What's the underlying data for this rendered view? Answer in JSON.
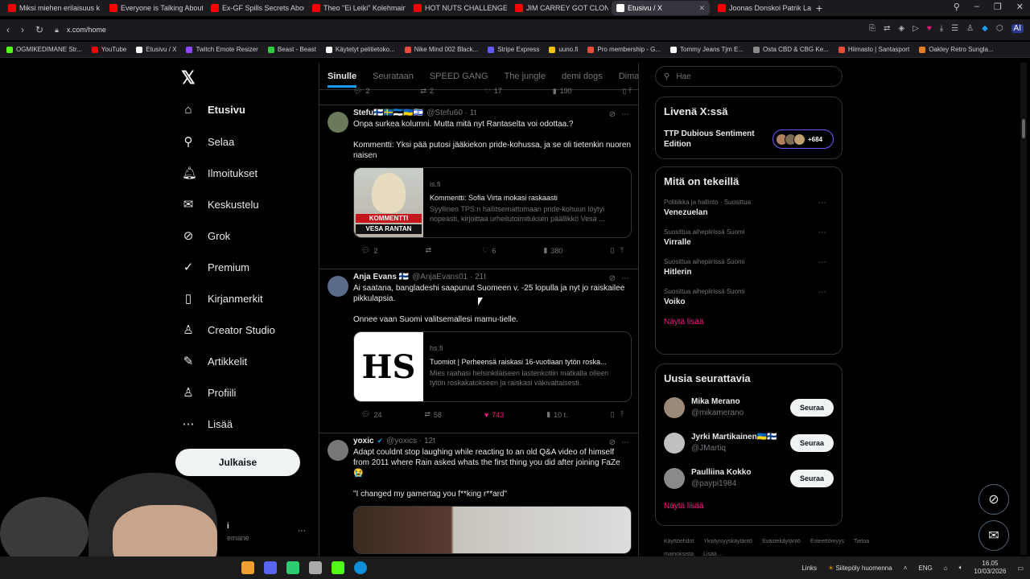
{
  "browser": {
    "tabs": [
      {
        "title": "Miksi miehen erilaisuus k",
        "color": "#ff0000"
      },
      {
        "title": "Everyone is Talking About",
        "color": "#ff0000"
      },
      {
        "title": "Ex-GF Spills Secrets About",
        "color": "#ff0000"
      },
      {
        "title": "Theo \"Ei Leiki\" Kolehmain",
        "color": "#ff0000"
      },
      {
        "title": "HOT NUTS CHALLENGE -",
        "color": "#ff0000"
      },
      {
        "title": "JIM CARREY GOT CLONED",
        "color": "#ff0000"
      },
      {
        "title": "Etusivu / X",
        "color": "#ffffff"
      },
      {
        "title": "Joonas Donskoi Patrik La",
        "color": "#ff0000"
      }
    ],
    "url": "x.com/home",
    "bookmarks": [
      {
        "label": "OGMIKEDIMANE Str...",
        "color": "#53fc18"
      },
      {
        "label": "YouTube",
        "color": "#ff0000"
      },
      {
        "label": "Etusivu / X",
        "color": "#ffffff"
      },
      {
        "label": "Twitch Emote Resizer",
        "color": "#9146ff"
      },
      {
        "label": "Beast - Beast",
        "color": "#2ecc40"
      },
      {
        "label": "Käytetyt pelitietoko...",
        "color": "#ffffff"
      },
      {
        "label": "Nike Mind 002 Black...",
        "color": "#e74c3c"
      },
      {
        "label": "Stripe Express",
        "color": "#635bff"
      },
      {
        "label": "uuno.fi",
        "color": "#f1c40f"
      },
      {
        "label": "Pro membership - G...",
        "color": "#e74c3c"
      },
      {
        "label": "Tommy Jeans Tjm E...",
        "color": "#ffffff"
      },
      {
        "label": "Osta CBD & CBG Ke...",
        "color": "#888888"
      },
      {
        "label": "Hiimasto | Santasport",
        "color": "#e74c3c"
      },
      {
        "label": "Oakley Retro Sungla...",
        "color": "#e67e22"
      }
    ]
  },
  "nav": {
    "items": [
      {
        "label": "Etusivu",
        "icon": "home-icon",
        "glyph": "⌂"
      },
      {
        "label": "Selaa",
        "icon": "search-icon",
        "glyph": "⚲"
      },
      {
        "label": "Ilmoitukset",
        "icon": "bell-icon",
        "glyph": "🔔︎"
      },
      {
        "label": "Keskustelu",
        "icon": "envelope-icon",
        "glyph": "✉"
      },
      {
        "label": "Grok",
        "icon": "grok-icon",
        "glyph": "⊘"
      },
      {
        "label": "Premium",
        "icon": "verified-icon",
        "glyph": "✓"
      },
      {
        "label": "Kirjanmerkit",
        "icon": "bookmark-icon",
        "glyph": "▯"
      },
      {
        "label": "Creator Studio",
        "icon": "creator-icon",
        "glyph": "♙"
      },
      {
        "label": "Artikkelit",
        "icon": "article-icon",
        "glyph": "✎"
      },
      {
        "label": "Profiili",
        "icon": "profile-icon",
        "glyph": "♙"
      },
      {
        "label": "Lisää",
        "icon": "more-icon",
        "glyph": "⋯"
      }
    ],
    "post_button": "Julkaise",
    "user_name": "i",
    "user_handle": "emane"
  },
  "feed": {
    "tabs": [
      "Sinulle",
      "Seurataan",
      "SPEED GANG",
      "The jungle",
      "demi dogs",
      "Dima's Dist"
    ],
    "top_actions": {
      "replies": "2",
      "reposts": "2",
      "likes": "17",
      "views": "190"
    },
    "posts": [
      {
        "name": "Stefu🇫🇮🇸🇪🇪🇪🇺🇦🇮🇱",
        "handle": "@Stefu60 · 1t",
        "text1": "Onpa surkea kolumni. Mutta mitä nyt Rantaselta voi odottaa.?",
        "text2": "Kommentti: Yksi pää putosi jääkiekon pride-kohussa, ja se oli tietenkin nuoren naisen",
        "card": {
          "domain": "is.fi",
          "title": "Kommentti: Sofia Virta mokasi raskaasti",
          "desc": "Syyllinen TPS:n hallitsemattomaan pride-kohuun löytyi nopeasti, kirjoittaa urheilutoimituksen päällikkö Vesa ...",
          "overlay1": "KOMMENTTI",
          "overlay2": "VESA RANTAN"
        },
        "actions": {
          "replies": "2",
          "reposts": "",
          "likes": "6",
          "views": "380"
        }
      },
      {
        "name": "Anja Evans 🇫🇮",
        "handle": "@AnjaEvans01 · 21t",
        "text1": "Ai saatana, bangladeshi saapunut Suomeen v. -25 lopulla ja nyt jo raiskailee pikkulapsia.",
        "text2": "Onnee vaan Suomi valitsemallesi mamu-tielle.",
        "card": {
          "domain": "hs.fi",
          "title": "Tuomiot | Perheensä raiskasi 16-vuotiaan tytön roska...",
          "desc": "Mies raahasi helsinkiläiseen lastenkotiin matkalla olleen tytön roskakatokseen ja raiskasi väkivaltaisesti.",
          "logo": "HS"
        },
        "actions": {
          "replies": "24",
          "reposts": "58",
          "likes": "743",
          "views": "10 t."
        }
      },
      {
        "name": "yoxic",
        "handle": "@yoxics · 12t",
        "text1": "Adapt couldnt stop laughing while reacting to an old Q&A video of himself from 2011 where Rain asked whats the first thing you did after joining FaZe 😭",
        "text2": "\"I changed my gamertag you f**king r**ard\""
      }
    ]
  },
  "right": {
    "search_placeholder": "Hae",
    "live": {
      "title": "Livenä X:ssä",
      "event": "TTP Dubious Sentiment Edition",
      "count": "+684"
    },
    "trends": {
      "title": "Mitä on tekeillä",
      "items": [
        {
          "meta": "Politiikka ja hallinto · Suosittua",
          "name": "Venezuelan"
        },
        {
          "meta": "Suosittua aihepiirissä Suomi",
          "name": "Virralle"
        },
        {
          "meta": "Suosittua aihepiirissä Suomi",
          "name": "Hitlerin"
        },
        {
          "meta": "Suosittua aihepiirissä Suomi",
          "name": "Voiko"
        }
      ],
      "show_more": "Näytä lisää"
    },
    "who_to_follow": {
      "title": "Uusia seurattavia",
      "items": [
        {
          "name": "Mika Merano",
          "handle": "@mikamerano",
          "button": "Seuraa"
        },
        {
          "name": "Jyrki Martikainen🇺🇦🇫🇮",
          "handle": "@JMartiq",
          "button": "Seuraa"
        },
        {
          "name": "Paulliina Kokko",
          "handle": "@paypi1984",
          "button": "Seuraa"
        }
      ],
      "show_more": "Näytä lisää"
    },
    "footer": [
      "Käyttöehdot",
      "Yksityisyyskäytäntö",
      "Evästekäytäntö",
      "Esteettömyys",
      "Tietoa mainoksista",
      "Lisää ..."
    ]
  },
  "taskbar": {
    "links": "Links",
    "weather": "Siitepöly huomenna",
    "lang": "ENG",
    "time": "16.05",
    "date": "10/03/2026"
  }
}
